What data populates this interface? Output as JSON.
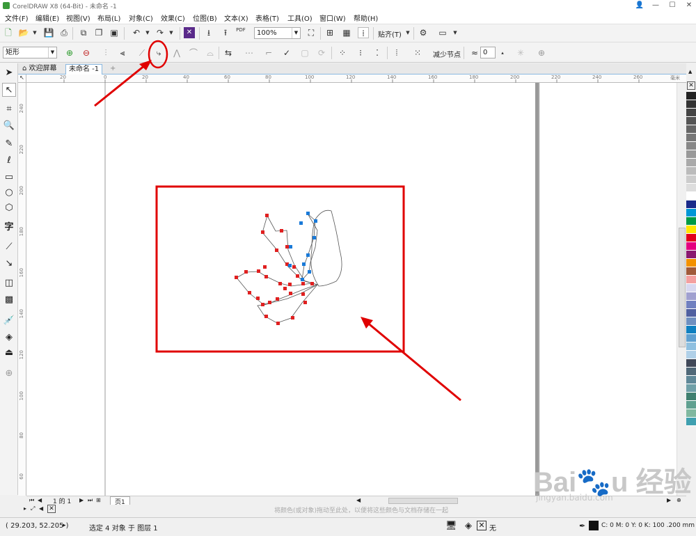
{
  "titlebar": {
    "title": "CorelDRAW X8 (64-Bit) - 未命名 -1",
    "minimize": "—",
    "maximize": "☐",
    "close": "✕"
  },
  "menu": [
    "文件(F)",
    "编辑(E)",
    "视图(V)",
    "布局(L)",
    "对象(C)",
    "效果(C)",
    "位图(B)",
    "文本(X)",
    "表格(T)",
    "工具(O)",
    "窗口(W)",
    "帮助(H)"
  ],
  "toolbar": {
    "zoom": "100%",
    "snap": "贴齐(T)",
    "pdf": "PDF"
  },
  "propertybar": {
    "shape": "矩形",
    "reduce_nodes": "减少节点",
    "curve_smooth": "0"
  },
  "tabs": {
    "welcome": "欢迎屏幕",
    "document": "未命名 -1",
    "add": "+"
  },
  "ruler": {
    "h": [
      "20",
      "0",
      "20",
      "40",
      "60",
      "80",
      "100",
      "120",
      "140",
      "160",
      "180",
      "200",
      "220",
      "240",
      "260"
    ],
    "v": [
      "240",
      "220",
      "200",
      "180",
      "160",
      "140",
      "120",
      "100",
      "80",
      "60"
    ],
    "unit": "毫米"
  },
  "pages": {
    "counter": "1 的 1",
    "page_tab": "页1"
  },
  "hint": "将颜色(或对象)拖动至此处，以便将这些颜色与文档存储在一起",
  "status": {
    "coords": "( 29.203, 52.205 )",
    "selection": "选定 4 对象 于 图层 1",
    "fill": "无",
    "outline": "C: 0 M: 0 Y: 0 K: 100  .200 mm"
  },
  "palette": [
    "#222222",
    "#333333",
    "#444444",
    "#555555",
    "#666666",
    "#777777",
    "#888888",
    "#999999",
    "#aaaaaa",
    "#bbbbbb",
    "#cccccc",
    "#dddddd",
    "#ffffff",
    "#1a2a8a",
    "#0096d6",
    "#009a44",
    "#ffe600",
    "#e2001a",
    "#e4007f",
    "#8a1a70",
    "#f39200",
    "#a05a3a",
    "#f4a0a0",
    "#d8d8f0",
    "#a0a0d0",
    "#7080c0",
    "#5060a0",
    "#7090c0",
    "#1080c0",
    "#60a0d0",
    "#90c0e0",
    "#b0d0e8",
    "#404858",
    "#506878",
    "#608898",
    "#70a0a8",
    "#408070",
    "#60a090",
    "#80b8a0",
    "#40a0b0"
  ]
}
